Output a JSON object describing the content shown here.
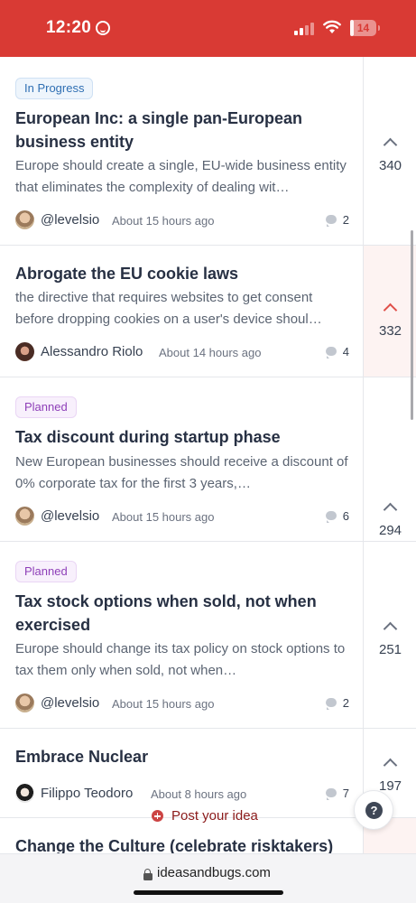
{
  "status_bar": {
    "time": "12:20",
    "battery": "14",
    "battery_level": 0.14
  },
  "posts": [
    {
      "status": "In Progress",
      "status_type": "progress",
      "title": "European Inc: a single pan-European business entity",
      "description": "Europe should create a single, EU-wide business entity that eliminates the complexity of dealing wit…",
      "author": "@levelsio",
      "time": "About 15 hours ago",
      "comments": "2",
      "votes": "340",
      "voted": false
    },
    {
      "status": "",
      "status_type": "",
      "title": "Abrogate the EU cookie laws",
      "description": "the directive that requires websites to get consent before dropping cookies on a user's device shoul…",
      "author": "Alessandro Riolo",
      "time": "About 14 hours ago",
      "comments": "4",
      "votes": "332",
      "voted": true
    },
    {
      "status": "Planned",
      "status_type": "planned",
      "title": "Tax discount during startup phase",
      "description": "New European businesses should receive a discount of 0% corporate tax for the first 3 years,…",
      "author": "@levelsio",
      "time": "About 15 hours ago",
      "comments": "6",
      "votes": "294",
      "voted": false
    },
    {
      "status": "Planned",
      "status_type": "planned",
      "title": "Tax stock options when sold, not when exercised",
      "description": "Europe should change its tax policy on stock options to tax them only when sold, not when…",
      "author": "@levelsio",
      "time": "About 15 hours ago",
      "comments": "2",
      "votes": "251",
      "voted": false
    },
    {
      "status": "",
      "status_type": "",
      "title": "Embrace Nuclear",
      "description": "",
      "author": "Filippo Teodoro",
      "time": "About 8 hours ago",
      "comments": "7",
      "votes": "197",
      "voted": false
    },
    {
      "status": "",
      "status_type": "",
      "title": "Change the Culture (celebrate risktakers)",
      "description": "",
      "author": "",
      "time": "",
      "comments": "",
      "votes": "",
      "voted": false
    }
  ],
  "post_idea": {
    "label": "Post your idea"
  },
  "help": {
    "label": "?"
  },
  "browser": {
    "domain": "ideasandbugs.com"
  },
  "colors": {
    "status_bar": "#d93a34",
    "accent": "#e0504a",
    "in_progress": "#2f6fb3",
    "planned": "#8e3fb8"
  },
  "icons": {
    "help": "question-mark-icon",
    "post": "plus-circle-icon",
    "lock": "lock-icon",
    "comment": "comment-icon",
    "upvote": "chevron-up-icon"
  }
}
